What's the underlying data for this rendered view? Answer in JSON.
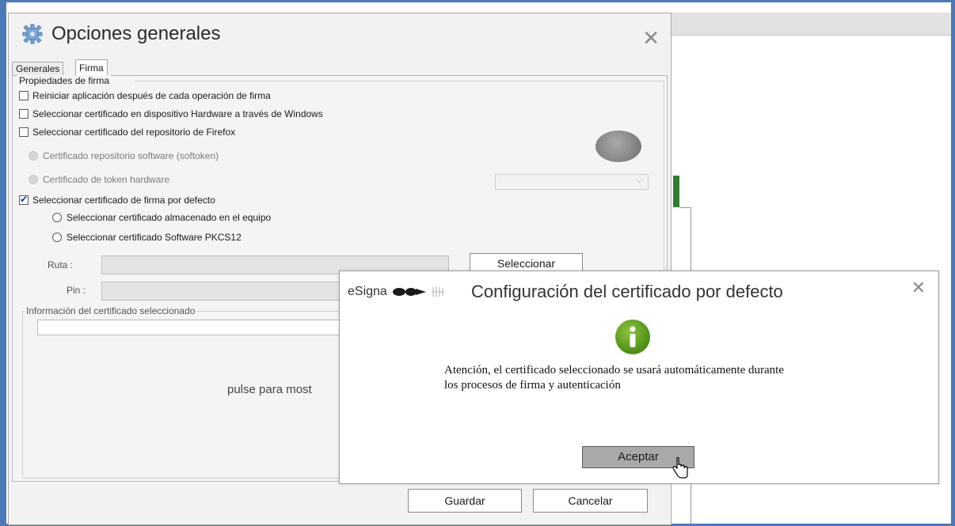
{
  "main_dialog": {
    "title": "Opciones generales",
    "close_glyph": "✕",
    "tabs": [
      {
        "label": "Generales",
        "active": false
      },
      {
        "label": "Firma",
        "active": true
      }
    ],
    "group_title": "Propiedades de firma",
    "checkboxes": [
      {
        "label": "Reiniciar aplicación después de cada operación de firma",
        "checked": false
      },
      {
        "label": "Seleccionar certificado en dispositivo Hardware a través de Windows",
        "checked": false
      },
      {
        "label": "Seleccionar certificado del repositorio de Firefox",
        "checked": false
      }
    ],
    "firefox_radios": [
      {
        "label": "Certificado repositorio software (softoken)",
        "enabled": false
      },
      {
        "label": "Certificado de token hardware",
        "enabled": false
      }
    ],
    "default_checkbox": {
      "label": "Seleccionar certificado de firma por defecto",
      "checked": true
    },
    "default_radios": [
      {
        "label": "Seleccionar certificado almacenado en el equipo"
      },
      {
        "label": "Seleccionar certificado Software PKCS12"
      }
    ],
    "ruta_label": "Ruta :",
    "pin_label": "Pin :",
    "select_button": "Seleccionar",
    "info_group_title": "Información del certificado seleccionado",
    "info_hint": "pulse para most",
    "save_button": "Guardar",
    "cancel_button": "Cancelar"
  },
  "popup": {
    "brand": "eSigna",
    "title": "Configuración del certificado por defecto",
    "close_glyph": "✕",
    "message": "Atención, el certificado seleccionado se usará automáticamente durante los procesos de firma y autenticación",
    "accept_button": "Aceptar"
  },
  "colors": {
    "frame_blue": "#4a7ab8",
    "info_green": "#5b9a1c",
    "accent_green": "#2e7d32"
  },
  "icons": [
    "gear-icon",
    "close-icon",
    "chevron-down-icon",
    "esigna-logo-icon",
    "info-icon",
    "hand-cursor-icon"
  ]
}
